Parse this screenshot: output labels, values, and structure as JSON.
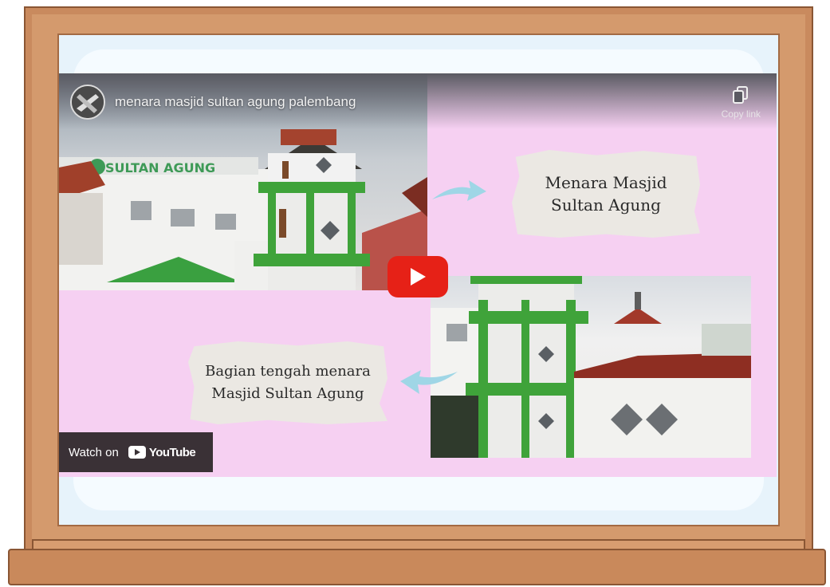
{
  "video": {
    "title": "menara masjid sultan agung palembang",
    "copy_link_label": "Copy link",
    "watch_on_label": "Watch on",
    "youtube_brand": "YouTube"
  },
  "slides": {
    "card_top": "Menara Masjid Sultan Agung",
    "card_bottom": "Bagian tengah menara Masjid Sultan Agung",
    "building_sign": "SULTAN AGUNG"
  },
  "icons": {
    "play": "play-icon",
    "copy": "copy-icon",
    "youtube": "youtube-logo-icon"
  },
  "colors": {
    "slide_background": "#f6d0f2",
    "play_button": "#e62117",
    "frame_wood": "#c98a5e",
    "tower_green": "#3fa33a"
  }
}
